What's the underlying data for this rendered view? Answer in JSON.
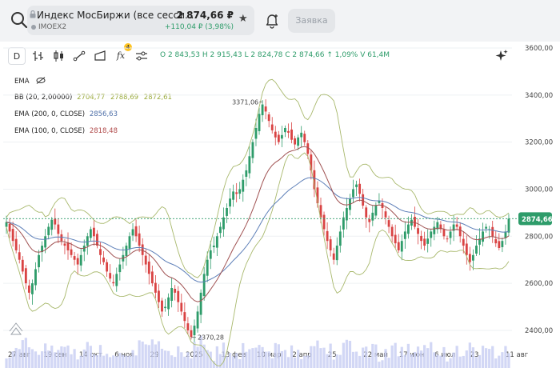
{
  "header": {
    "instrument_name": "Индекс МосБиржи (все сесси...",
    "ticker": "IMOEX2",
    "price": "2 874,66 ₽",
    "change": "+110,04 ₽ (3,98%)",
    "order_button": "Заявка"
  },
  "toolbar": {
    "interval_label": "D",
    "indicator_badge": "4",
    "ohlc": "O 2 843,53  H 2 915,43  L 2 824,78  C 2 874,66  ↑ 1,09%  V 61,4M"
  },
  "legend": {
    "ema_toggle_label": "EMA",
    "bb_label": "BB (20, 2,00000)",
    "bb_values": [
      "2704,77",
      "2788,69",
      "2872,61"
    ],
    "ema200_label": "EMA (200, 0, CLOSE)",
    "ema200_value": "2856,63",
    "ema100_label": "EMA (100, 0, CLOSE)",
    "ema100_value": "2818,48"
  },
  "colors": {
    "up": "#2e9c6a",
    "down": "#d94343",
    "ema200": "#5d7fb8",
    "ema100": "#a05252",
    "bb": "#a8b86c",
    "volume": "#c7cdf3",
    "last_price_bg": "#2e9c6a"
  },
  "chart_data": {
    "type": "candlestick",
    "y_axis": {
      "ticks": [
        "3600,00",
        "3400,00",
        "3200,00",
        "3000,00",
        "2800,00",
        "2600,00",
        "2400,00"
      ],
      "tick_values": [
        3600,
        3400,
        3200,
        3000,
        2800,
        2600,
        2400
      ],
      "ylim": [
        2240,
        3600
      ]
    },
    "x_axis": {
      "ticks": [
        "27 авг",
        "19 сен",
        "14 окт",
        "6 ноя",
        "29",
        "2025",
        "13 фев",
        "10 мар",
        "2 апр",
        "25",
        "22 май",
        "17 июн",
        "6 июл",
        "23",
        "11 авг"
      ]
    },
    "last_price": 2874.66,
    "last_price_label": "2874,66",
    "annotations": [
      {
        "label": "3371,06",
        "value": 3371.06,
        "kind": "high"
      },
      {
        "label": "2370,28",
        "value": 2370.28,
        "kind": "low"
      }
    ],
    "close_path": [
      2860,
      2820,
      2780,
      2740,
      2700,
      2650,
      2600,
      2560,
      2600,
      2660,
      2720,
      2760,
      2800,
      2840,
      2870,
      2850,
      2810,
      2780,
      2760,
      2740,
      2720,
      2700,
      2680,
      2720,
      2760,
      2800,
      2830,
      2800,
      2760,
      2720,
      2690,
      2650,
      2620,
      2600,
      2640,
      2680,
      2720,
      2760,
      2800,
      2830,
      2800,
      2760,
      2720,
      2680,
      2640,
      2600,
      2560,
      2520,
      2480,
      2500,
      2540,
      2580,
      2560,
      2520,
      2480,
      2440,
      2400,
      2372,
      2420,
      2480,
      2560,
      2640,
      2700,
      2740,
      2760,
      2800,
      2840,
      2880,
      2920,
      2960,
      2990,
      2980,
      3000,
      3040,
      3080,
      3140,
      3200,
      3260,
      3320,
      3360,
      3330,
      3290,
      3250,
      3220,
      3200,
      3230,
      3260,
      3240,
      3210,
      3190,
      3220,
      3240,
      3200,
      3150,
      3080,
      3000,
      2940,
      2880,
      2830,
      2780,
      2740,
      2700,
      2760,
      2820,
      2880,
      2920,
      2960,
      3000,
      3020,
      2980,
      2930,
      2880,
      2860,
      2900,
      2930,
      2950,
      2920,
      2880,
      2840,
      2800,
      2770,
      2740,
      2780,
      2820,
      2850,
      2870,
      2840,
      2810,
      2780,
      2760,
      2790,
      2820,
      2840,
      2860,
      2830,
      2800,
      2790,
      2820,
      2850,
      2840,
      2800,
      2760,
      2720,
      2690,
      2720,
      2760,
      2790,
      2820,
      2840,
      2830,
      2800,
      2770,
      2750,
      2780,
      2820,
      2874.66
    ]
  }
}
